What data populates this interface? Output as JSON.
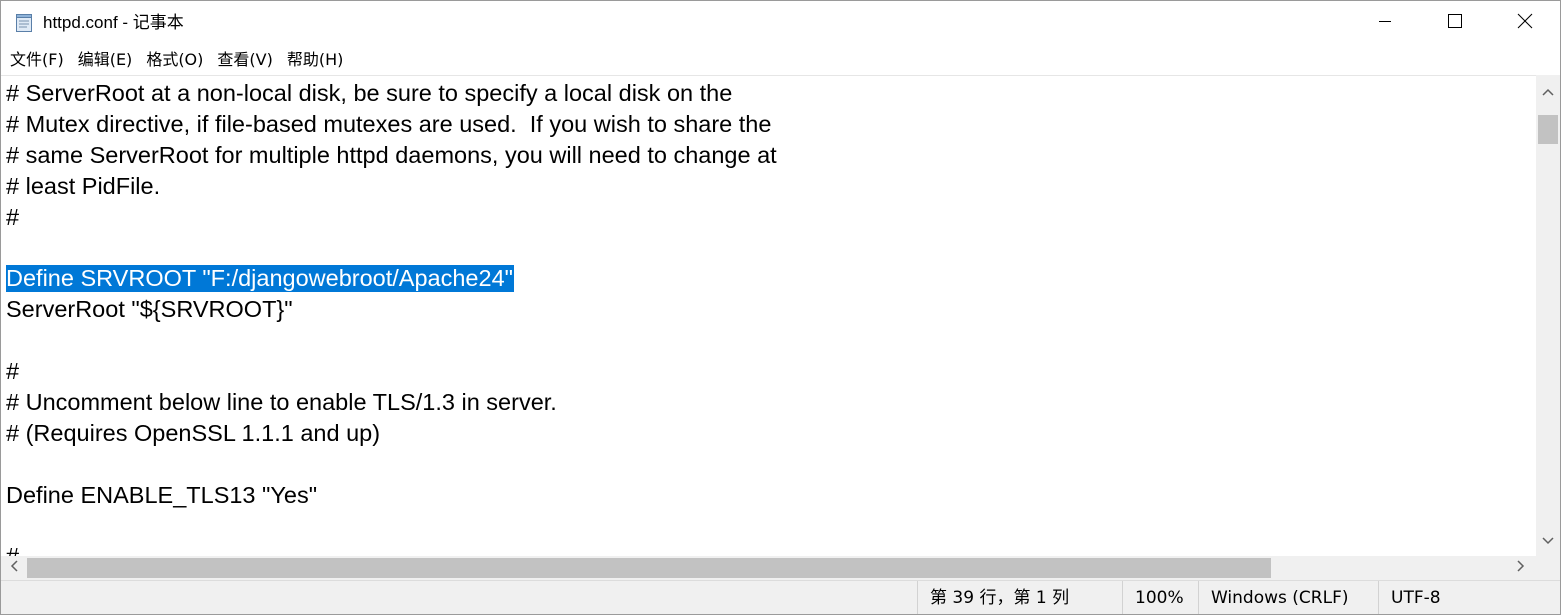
{
  "window": {
    "title": "httpd.conf - 记事本"
  },
  "icons": {
    "app": "notepad-icon",
    "minimize": "minimize-icon",
    "maximize": "maximize-icon",
    "close": "close-icon",
    "scroll_up": "arrow-up-icon",
    "scroll_down": "arrow-down-icon",
    "scroll_left": "arrow-left-icon",
    "scroll_right": "arrow-right-icon"
  },
  "menu": {
    "items": [
      {
        "label": "文件(F)"
      },
      {
        "label": "编辑(E)"
      },
      {
        "label": "格式(O)"
      },
      {
        "label": "查看(V)"
      },
      {
        "label": "帮助(H)"
      }
    ]
  },
  "editor": {
    "lines": [
      {
        "before": "# ServerRoot at a non-local disk, be sure to specify a local disk on the",
        "selected": "",
        "after": ""
      },
      {
        "before": "# Mutex directive, if file-based mutexes are used.  If you wish to share the",
        "selected": "",
        "after": ""
      },
      {
        "before": "# same ServerRoot for multiple httpd daemons, you will need to change at",
        "selected": "",
        "after": ""
      },
      {
        "before": "# least PidFile.",
        "selected": "",
        "after": ""
      },
      {
        "before": "#",
        "selected": "",
        "after": ""
      },
      {
        "before": "",
        "selected": "",
        "after": ""
      },
      {
        "before": "",
        "selected": "Define SRVROOT \"F:/djangowebroot/Apache24\"",
        "after": ""
      },
      {
        "before": "ServerRoot \"${SRVROOT}\"",
        "selected": "",
        "after": ""
      },
      {
        "before": "",
        "selected": "",
        "after": ""
      },
      {
        "before": "#",
        "selected": "",
        "after": ""
      },
      {
        "before": "# Uncomment below line to enable TLS/1.3 in server.",
        "selected": "",
        "after": ""
      },
      {
        "before": "# (Requires OpenSSL 1.1.1 and up)",
        "selected": "",
        "after": ""
      },
      {
        "before": "",
        "selected": "",
        "after": ""
      },
      {
        "before": "Define ENABLE_TLS13 \"Yes\"",
        "selected": "",
        "after": ""
      },
      {
        "before": "",
        "selected": "",
        "after": ""
      },
      {
        "before": "#",
        "selected": "",
        "after": ""
      }
    ],
    "selection_color": "#0078d7"
  },
  "scrollbars": {
    "vertical": {
      "position_fraction": 0.02,
      "visible_fraction": 0.07
    },
    "horizontal": {
      "position_fraction": 0.0,
      "visible_fraction": 0.84
    }
  },
  "statusbar": {
    "position": "第 39 行，第 1 列",
    "zoom": "100%",
    "line_ending": "Windows (CRLF)",
    "encoding": "UTF-8"
  }
}
